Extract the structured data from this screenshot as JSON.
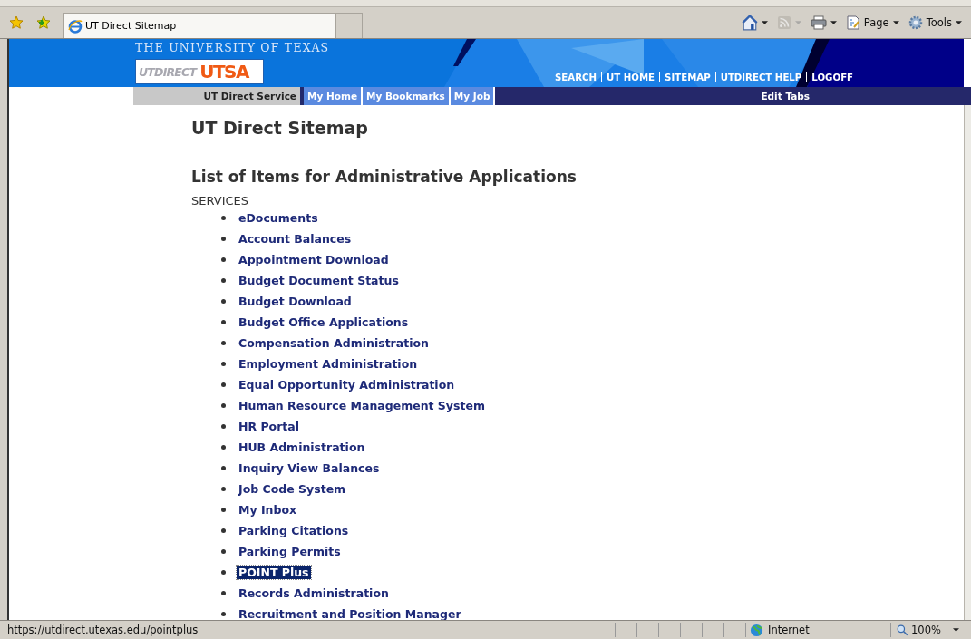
{
  "browser": {
    "tabs": [
      {
        "title": "UT Direct Sitemap",
        "selected": true
      }
    ],
    "toolbar": [
      {
        "kind": "home",
        "disabled": false
      },
      {
        "kind": "feeds",
        "disabled": true
      },
      {
        "kind": "print",
        "disabled": false
      },
      {
        "kind": "page",
        "label": "Page",
        "disabled": false
      },
      {
        "kind": "tools",
        "label": "Tools",
        "disabled": false
      }
    ]
  },
  "header": {
    "university": "THE UNIVERSITY OF TEXAS",
    "logo_left": "UTDIRECT",
    "logo_right": "UTSA",
    "links": [
      "SEARCH",
      "UT HOME",
      "SITEMAP",
      "UTDIRECT HELP",
      "LOGOFF"
    ],
    "tabs": [
      {
        "label": "UT Direct Service",
        "selected": true
      },
      {
        "label": "My Home",
        "selected": false
      },
      {
        "label": "My Bookmarks",
        "selected": false
      },
      {
        "label": "My Job",
        "selected": false
      }
    ],
    "edit_tabs": "Edit Tabs"
  },
  "page": {
    "title": "UT Direct Sitemap",
    "subtitle": "List of Items for Administrative Applications",
    "section": "SERVICES",
    "items": [
      {
        "label": "eDocuments",
        "selected": false
      },
      {
        "label": "Account Balances",
        "selected": false
      },
      {
        "label": "Appointment Download",
        "selected": false
      },
      {
        "label": "Budget Document Status",
        "selected": false
      },
      {
        "label": "Budget Download",
        "selected": false
      },
      {
        "label": "Budget Office Applications",
        "selected": false
      },
      {
        "label": "Compensation Administration",
        "selected": false
      },
      {
        "label": "Employment Administration",
        "selected": false
      },
      {
        "label": "Equal Opportunity Administration",
        "selected": false
      },
      {
        "label": "Human Resource Management System",
        "selected": false
      },
      {
        "label": "HR Portal",
        "selected": false
      },
      {
        "label": "HUB Administration",
        "selected": false
      },
      {
        "label": "Inquiry View Balances",
        "selected": false
      },
      {
        "label": "Job Code System",
        "selected": false
      },
      {
        "label": "My Inbox",
        "selected": false
      },
      {
        "label": "Parking Citations",
        "selected": false
      },
      {
        "label": "Parking Permits",
        "selected": false
      },
      {
        "label": "POINT Plus",
        "selected": true
      },
      {
        "label": "Records Administration",
        "selected": false
      },
      {
        "label": "Recruitment and Position Manager",
        "selected": false
      }
    ]
  },
  "status_bar": {
    "url": "https://utdirect.utexas.edu/pointplus",
    "zone": "Internet",
    "zoom": "100%"
  }
}
